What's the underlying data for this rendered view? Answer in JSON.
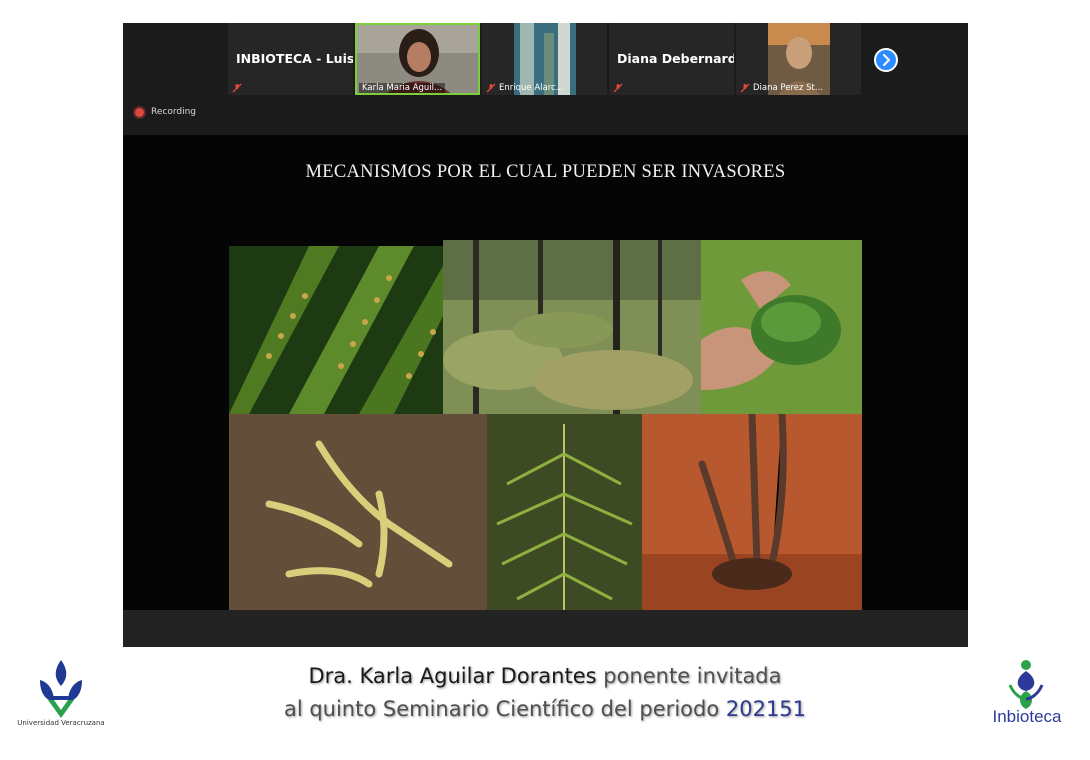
{
  "participants": [
    {
      "name": "INBIOTECA - Luis",
      "label": "",
      "has_video": false,
      "muted": true
    },
    {
      "name": "",
      "label": "Karla Maria Aguil...",
      "has_video": true,
      "muted": false,
      "active": true
    },
    {
      "name": "",
      "label": "Enrique Alarc...",
      "has_video": true,
      "muted": true
    },
    {
      "name": "Diana Debernardi",
      "label": "",
      "has_video": false,
      "muted": true
    },
    {
      "name": "",
      "label": "Diana Perez St...",
      "has_video": true,
      "muted": true
    }
  ],
  "next_button_icon": "chevron-right-icon",
  "recording": {
    "label": "Recording"
  },
  "slide": {
    "title": "MECANISMOS POR EL CUAL PUEDEN SER INVASORES"
  },
  "caption": {
    "line1_name": "Dra. Karla Aguilar Dorantes",
    "line1_rest": " ponente invitada",
    "line2_rest": "al quinto Seminario Científico del periodo ",
    "line2_period": "202151"
  },
  "logos": {
    "left_text": "Universidad Veracruzana",
    "right_text": "Inbioteca"
  },
  "colors": {
    "zoom_blue": "#2d8cff",
    "active_speaker": "#7ccf3b",
    "recording_red": "#e0483e",
    "caption_blue": "#2c3a8f"
  }
}
